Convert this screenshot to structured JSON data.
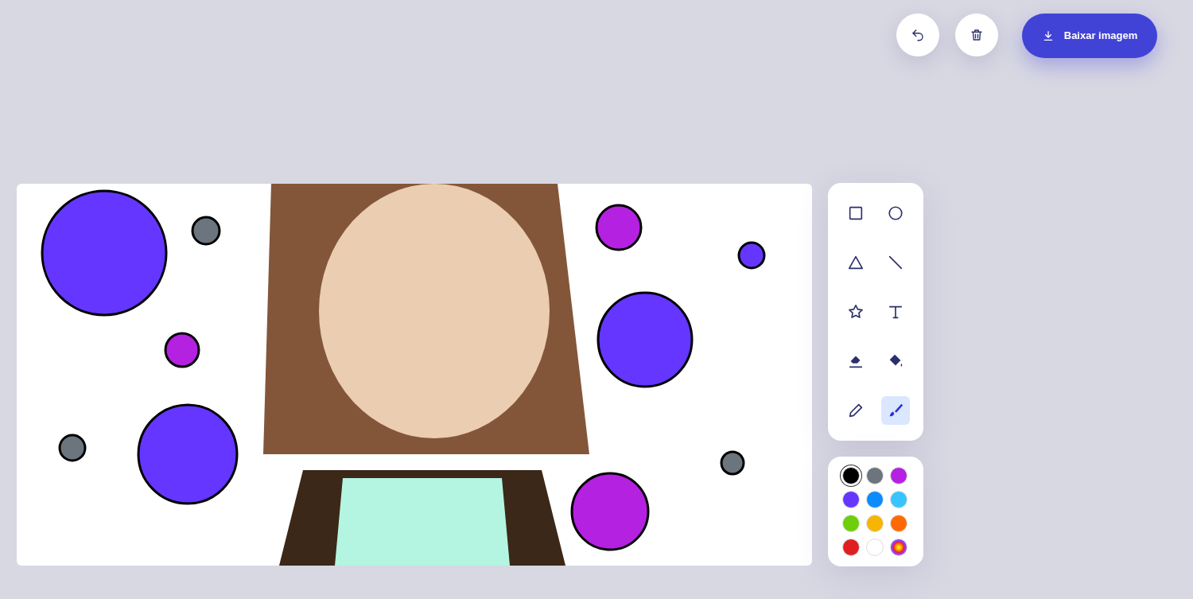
{
  "actions": [
    {
      "kind": "undo"
    },
    {
      "kind": "delete"
    },
    {
      "kind": "download",
      "label": "Baixar imagem"
    }
  ],
  "tools": [
    {
      "kind": "square",
      "selected": false
    },
    {
      "kind": "circle",
      "selected": false
    },
    {
      "kind": "triangle",
      "selected": false
    },
    {
      "kind": "line",
      "selected": false
    },
    {
      "kind": "star",
      "selected": false
    },
    {
      "kind": "text",
      "selected": false
    },
    {
      "kind": "eraser",
      "selected": false
    },
    {
      "kind": "fill",
      "selected": false
    },
    {
      "kind": "pencil",
      "selected": false
    },
    {
      "kind": "brush",
      "selected": true
    }
  ],
  "colors": [
    {
      "kind": "swatch",
      "color": "#000000",
      "selected": true
    },
    {
      "kind": "swatch",
      "color": "#6c757d",
      "selected": false
    },
    {
      "kind": "swatch",
      "color": "#b421e0",
      "selected": false
    },
    {
      "kind": "swatch",
      "color": "#6436ff",
      "selected": false
    },
    {
      "kind": "swatch",
      "color": "#0a8cff",
      "selected": false
    },
    {
      "kind": "swatch",
      "color": "#38c4ff",
      "selected": false
    },
    {
      "kind": "swatch",
      "color": "#6ccf0a",
      "selected": false
    },
    {
      "kind": "swatch",
      "color": "#f7b500",
      "selected": false
    },
    {
      "kind": "swatch",
      "color": "#ff6a00",
      "selected": false
    },
    {
      "kind": "swatch",
      "color": "#e02020",
      "selected": false
    },
    {
      "kind": "swatch",
      "color": "#ffffff",
      "selected": false
    },
    {
      "kind": "custom",
      "selected": false
    }
  ]
}
